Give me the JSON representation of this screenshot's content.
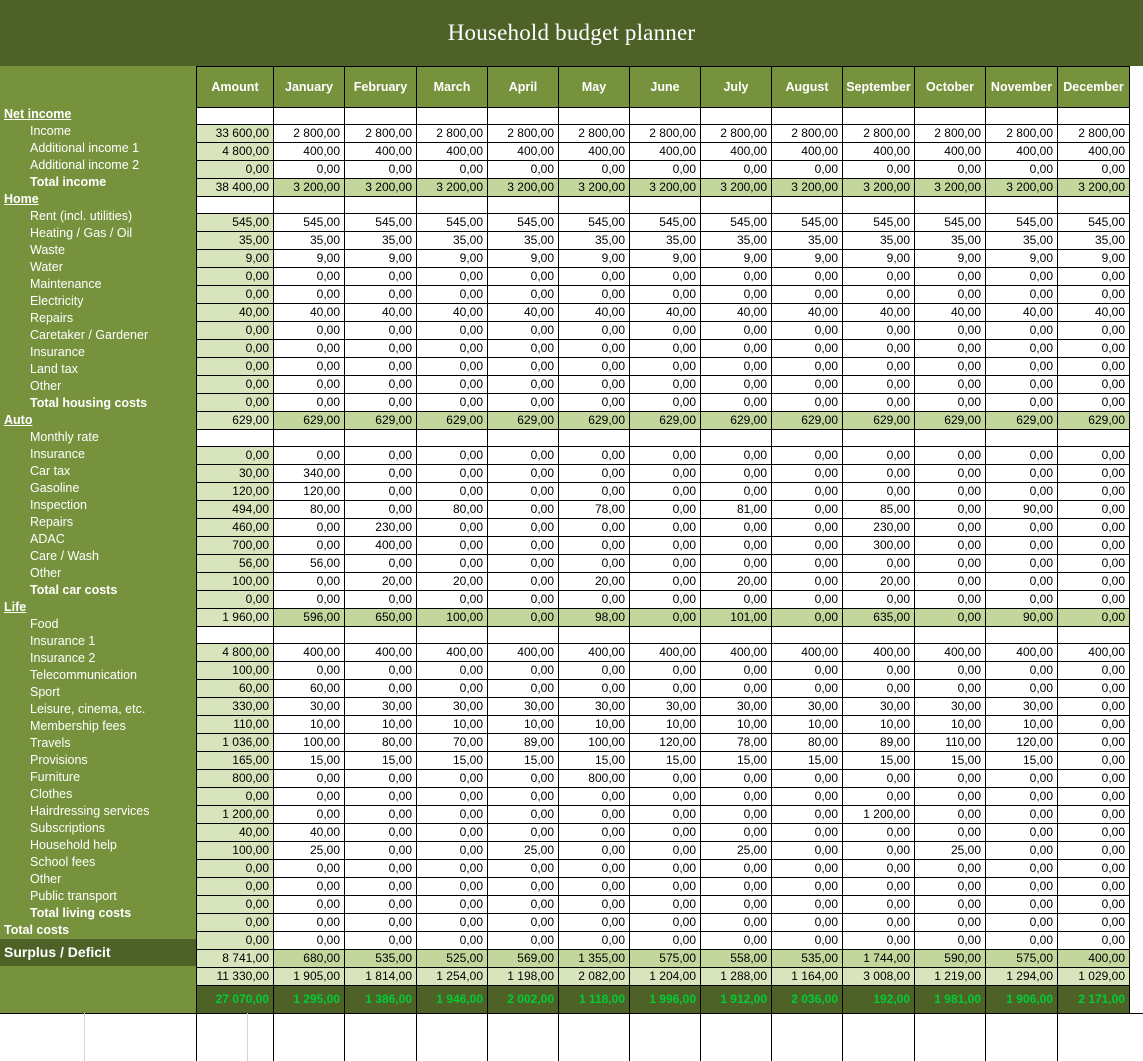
{
  "title": "Household budget planner",
  "theme": {
    "banner": "#4e6228",
    "header": "#76923c",
    "amount_fill": "#d8e4bc",
    "total_fill": "#c3d69b",
    "surplus_bg": "#4e6228",
    "surplus_text": "#00cc33"
  },
  "columns": [
    "Amount",
    "January",
    "February",
    "March",
    "April",
    "May",
    "June",
    "July",
    "August",
    "September",
    "October",
    "November",
    "December"
  ],
  "sections": [
    {
      "name": "Net income",
      "rows": [
        {
          "label": "Income",
          "kind": "item",
          "values": [
            "33 600,00",
            "2 800,00",
            "2 800,00",
            "2 800,00",
            "2 800,00",
            "2 800,00",
            "2 800,00",
            "2 800,00",
            "2 800,00",
            "2 800,00",
            "2 800,00",
            "2 800,00",
            "2 800,00"
          ]
        },
        {
          "label": "Additional income 1",
          "kind": "item",
          "values": [
            "4 800,00",
            "400,00",
            "400,00",
            "400,00",
            "400,00",
            "400,00",
            "400,00",
            "400,00",
            "400,00",
            "400,00",
            "400,00",
            "400,00",
            "400,00"
          ]
        },
        {
          "label": "Additional income 2",
          "kind": "item",
          "values": [
            "0,00",
            "0,00",
            "0,00",
            "0,00",
            "0,00",
            "0,00",
            "0,00",
            "0,00",
            "0,00",
            "0,00",
            "0,00",
            "0,00",
            "0,00"
          ]
        },
        {
          "label": "Total income",
          "kind": "total",
          "values": [
            "38 400,00",
            "3 200,00",
            "3 200,00",
            "3 200,00",
            "3 200,00",
            "3 200,00",
            "3 200,00",
            "3 200,00",
            "3 200,00",
            "3 200,00",
            "3 200,00",
            "3 200,00",
            "3 200,00"
          ]
        }
      ]
    },
    {
      "name": "Home",
      "rows": [
        {
          "label": "Rent (incl. utilities)",
          "kind": "item",
          "values": [
            "545,00",
            "545,00",
            "545,00",
            "545,00",
            "545,00",
            "545,00",
            "545,00",
            "545,00",
            "545,00",
            "545,00",
            "545,00",
            "545,00",
            "545,00"
          ]
        },
        {
          "label": "Heating / Gas / Oil",
          "kind": "item",
          "values": [
            "35,00",
            "35,00",
            "35,00",
            "35,00",
            "35,00",
            "35,00",
            "35,00",
            "35,00",
            "35,00",
            "35,00",
            "35,00",
            "35,00",
            "35,00"
          ]
        },
        {
          "label": "Waste",
          "kind": "item",
          "values": [
            "9,00",
            "9,00",
            "9,00",
            "9,00",
            "9,00",
            "9,00",
            "9,00",
            "9,00",
            "9,00",
            "9,00",
            "9,00",
            "9,00",
            "9,00"
          ]
        },
        {
          "label": "Water",
          "kind": "item",
          "values": [
            "0,00",
            "0,00",
            "0,00",
            "0,00",
            "0,00",
            "0,00",
            "0,00",
            "0,00",
            "0,00",
            "0,00",
            "0,00",
            "0,00",
            "0,00"
          ]
        },
        {
          "label": "Maintenance",
          "kind": "item",
          "values": [
            "0,00",
            "0,00",
            "0,00",
            "0,00",
            "0,00",
            "0,00",
            "0,00",
            "0,00",
            "0,00",
            "0,00",
            "0,00",
            "0,00",
            "0,00"
          ]
        },
        {
          "label": "Electricity",
          "kind": "item",
          "values": [
            "40,00",
            "40,00",
            "40,00",
            "40,00",
            "40,00",
            "40,00",
            "40,00",
            "40,00",
            "40,00",
            "40,00",
            "40,00",
            "40,00",
            "40,00"
          ]
        },
        {
          "label": "Repairs",
          "kind": "item",
          "values": [
            "0,00",
            "0,00",
            "0,00",
            "0,00",
            "0,00",
            "0,00",
            "0,00",
            "0,00",
            "0,00",
            "0,00",
            "0,00",
            "0,00",
            "0,00"
          ]
        },
        {
          "label": "Caretaker / Gardener",
          "kind": "item",
          "values": [
            "0,00",
            "0,00",
            "0,00",
            "0,00",
            "0,00",
            "0,00",
            "0,00",
            "0,00",
            "0,00",
            "0,00",
            "0,00",
            "0,00",
            "0,00"
          ]
        },
        {
          "label": "Insurance",
          "kind": "item",
          "values": [
            "0,00",
            "0,00",
            "0,00",
            "0,00",
            "0,00",
            "0,00",
            "0,00",
            "0,00",
            "0,00",
            "0,00",
            "0,00",
            "0,00",
            "0,00"
          ]
        },
        {
          "label": "Land tax",
          "kind": "item",
          "values": [
            "0,00",
            "0,00",
            "0,00",
            "0,00",
            "0,00",
            "0,00",
            "0,00",
            "0,00",
            "0,00",
            "0,00",
            "0,00",
            "0,00",
            "0,00"
          ]
        },
        {
          "label": "Other",
          "kind": "item",
          "values": [
            "0,00",
            "0,00",
            "0,00",
            "0,00",
            "0,00",
            "0,00",
            "0,00",
            "0,00",
            "0,00",
            "0,00",
            "0,00",
            "0,00",
            "0,00"
          ]
        },
        {
          "label": "Total housing costs",
          "kind": "total",
          "values": [
            "629,00",
            "629,00",
            "629,00",
            "629,00",
            "629,00",
            "629,00",
            "629,00",
            "629,00",
            "629,00",
            "629,00",
            "629,00",
            "629,00",
            "629,00"
          ]
        }
      ]
    },
    {
      "name": "Auto",
      "rows": [
        {
          "label": "Monthly rate",
          "kind": "item",
          "values": [
            "0,00",
            "0,00",
            "0,00",
            "0,00",
            "0,00",
            "0,00",
            "0,00",
            "0,00",
            "0,00",
            "0,00",
            "0,00",
            "0,00",
            "0,00"
          ]
        },
        {
          "label": "Insurance",
          "kind": "item",
          "values": [
            "30,00",
            "340,00",
            "0,00",
            "0,00",
            "0,00",
            "0,00",
            "0,00",
            "0,00",
            "0,00",
            "0,00",
            "0,00",
            "0,00",
            "0,00"
          ]
        },
        {
          "label": "Car tax",
          "kind": "item",
          "values": [
            "120,00",
            "120,00",
            "0,00",
            "0,00",
            "0,00",
            "0,00",
            "0,00",
            "0,00",
            "0,00",
            "0,00",
            "0,00",
            "0,00",
            "0,00"
          ]
        },
        {
          "label": "Gasoline",
          "kind": "item",
          "values": [
            "494,00",
            "80,00",
            "0,00",
            "80,00",
            "0,00",
            "78,00",
            "0,00",
            "81,00",
            "0,00",
            "85,00",
            "0,00",
            "90,00",
            "0,00"
          ]
        },
        {
          "label": "Inspection",
          "kind": "item",
          "values": [
            "460,00",
            "0,00",
            "230,00",
            "0,00",
            "0,00",
            "0,00",
            "0,00",
            "0,00",
            "0,00",
            "230,00",
            "0,00",
            "0,00",
            "0,00"
          ]
        },
        {
          "label": "Repairs",
          "kind": "item",
          "values": [
            "700,00",
            "0,00",
            "400,00",
            "0,00",
            "0,00",
            "0,00",
            "0,00",
            "0,00",
            "0,00",
            "300,00",
            "0,00",
            "0,00",
            "0,00"
          ]
        },
        {
          "label": "ADAC",
          "kind": "item",
          "values": [
            "56,00",
            "56,00",
            "0,00",
            "0,00",
            "0,00",
            "0,00",
            "0,00",
            "0,00",
            "0,00",
            "0,00",
            "0,00",
            "0,00",
            "0,00"
          ]
        },
        {
          "label": "Care / Wash",
          "kind": "item",
          "values": [
            "100,00",
            "0,00",
            "20,00",
            "20,00",
            "0,00",
            "20,00",
            "0,00",
            "20,00",
            "0,00",
            "20,00",
            "0,00",
            "0,00",
            "0,00"
          ]
        },
        {
          "label": "Other",
          "kind": "item",
          "values": [
            "0,00",
            "0,00",
            "0,00",
            "0,00",
            "0,00",
            "0,00",
            "0,00",
            "0,00",
            "0,00",
            "0,00",
            "0,00",
            "0,00",
            "0,00"
          ]
        },
        {
          "label": "Total car costs",
          "kind": "total",
          "values": [
            "1 960,00",
            "596,00",
            "650,00",
            "100,00",
            "0,00",
            "98,00",
            "0,00",
            "101,00",
            "0,00",
            "635,00",
            "0,00",
            "90,00",
            "0,00"
          ]
        }
      ]
    },
    {
      "name": "Life",
      "rows": [
        {
          "label": "Food",
          "kind": "item",
          "values": [
            "4 800,00",
            "400,00",
            "400,00",
            "400,00",
            "400,00",
            "400,00",
            "400,00",
            "400,00",
            "400,00",
            "400,00",
            "400,00",
            "400,00",
            "400,00"
          ]
        },
        {
          "label": "Insurance 1",
          "kind": "item",
          "values": [
            "100,00",
            "0,00",
            "0,00",
            "0,00",
            "0,00",
            "0,00",
            "0,00",
            "0,00",
            "0,00",
            "0,00",
            "0,00",
            "0,00",
            "0,00"
          ]
        },
        {
          "label": "Insurance 2",
          "kind": "item",
          "values": [
            "60,00",
            "60,00",
            "0,00",
            "0,00",
            "0,00",
            "0,00",
            "0,00",
            "0,00",
            "0,00",
            "0,00",
            "0,00",
            "0,00",
            "0,00"
          ]
        },
        {
          "label": "Telecommunication",
          "kind": "item",
          "values": [
            "330,00",
            "30,00",
            "30,00",
            "30,00",
            "30,00",
            "30,00",
            "30,00",
            "30,00",
            "30,00",
            "30,00",
            "30,00",
            "30,00",
            "0,00"
          ]
        },
        {
          "label": "Sport",
          "kind": "item",
          "values": [
            "110,00",
            "10,00",
            "10,00",
            "10,00",
            "10,00",
            "10,00",
            "10,00",
            "10,00",
            "10,00",
            "10,00",
            "10,00",
            "10,00",
            "0,00"
          ]
        },
        {
          "label": "Leisure, cinema, etc.",
          "kind": "item",
          "values": [
            "1 036,00",
            "100,00",
            "80,00",
            "70,00",
            "89,00",
            "100,00",
            "120,00",
            "78,00",
            "80,00",
            "89,00",
            "110,00",
            "120,00",
            "0,00"
          ]
        },
        {
          "label": "Membership fees",
          "kind": "item",
          "values": [
            "165,00",
            "15,00",
            "15,00",
            "15,00",
            "15,00",
            "15,00",
            "15,00",
            "15,00",
            "15,00",
            "15,00",
            "15,00",
            "15,00",
            "0,00"
          ]
        },
        {
          "label": "Travels",
          "kind": "item",
          "values": [
            "800,00",
            "0,00",
            "0,00",
            "0,00",
            "0,00",
            "800,00",
            "0,00",
            "0,00",
            "0,00",
            "0,00",
            "0,00",
            "0,00",
            "0,00"
          ]
        },
        {
          "label": "Provisions",
          "kind": "item",
          "values": [
            "0,00",
            "0,00",
            "0,00",
            "0,00",
            "0,00",
            "0,00",
            "0,00",
            "0,00",
            "0,00",
            "0,00",
            "0,00",
            "0,00",
            "0,00"
          ]
        },
        {
          "label": "Furniture",
          "kind": "item",
          "values": [
            "1 200,00",
            "0,00",
            "0,00",
            "0,00",
            "0,00",
            "0,00",
            "0,00",
            "0,00",
            "0,00",
            "1 200,00",
            "0,00",
            "0,00",
            "0,00"
          ]
        },
        {
          "label": "Clothes",
          "kind": "item",
          "values": [
            "40,00",
            "40,00",
            "0,00",
            "0,00",
            "0,00",
            "0,00",
            "0,00",
            "0,00",
            "0,00",
            "0,00",
            "0,00",
            "0,00",
            "0,00"
          ]
        },
        {
          "label": "Hairdressing services",
          "kind": "item",
          "values": [
            "100,00",
            "25,00",
            "0,00",
            "0,00",
            "25,00",
            "0,00",
            "0,00",
            "25,00",
            "0,00",
            "0,00",
            "25,00",
            "0,00",
            "0,00"
          ]
        },
        {
          "label": "Subscriptions",
          "kind": "item",
          "values": [
            "0,00",
            "0,00",
            "0,00",
            "0,00",
            "0,00",
            "0,00",
            "0,00",
            "0,00",
            "0,00",
            "0,00",
            "0,00",
            "0,00",
            "0,00"
          ]
        },
        {
          "label": "Household help",
          "kind": "item",
          "values": [
            "0,00",
            "0,00",
            "0,00",
            "0,00",
            "0,00",
            "0,00",
            "0,00",
            "0,00",
            "0,00",
            "0,00",
            "0,00",
            "0,00",
            "0,00"
          ]
        },
        {
          "label": "School fees",
          "kind": "item",
          "values": [
            "0,00",
            "0,00",
            "0,00",
            "0,00",
            "0,00",
            "0,00",
            "0,00",
            "0,00",
            "0,00",
            "0,00",
            "0,00",
            "0,00",
            "0,00"
          ]
        },
        {
          "label": "Other",
          "kind": "item",
          "values": [
            "0,00",
            "0,00",
            "0,00",
            "0,00",
            "0,00",
            "0,00",
            "0,00",
            "0,00",
            "0,00",
            "0,00",
            "0,00",
            "0,00",
            "0,00"
          ]
        },
        {
          "label": "Public transport",
          "kind": "item",
          "values": [
            "0,00",
            "0,00",
            "0,00",
            "0,00",
            "0,00",
            "0,00",
            "0,00",
            "0,00",
            "0,00",
            "0,00",
            "0,00",
            "0,00",
            "0,00"
          ]
        },
        {
          "label": "Total living costs",
          "kind": "total",
          "values": [
            "8 741,00",
            "680,00",
            "535,00",
            "525,00",
            "569,00",
            "1 355,00",
            "575,00",
            "558,00",
            "535,00",
            "1 744,00",
            "590,00",
            "575,00",
            "400,00"
          ]
        }
      ]
    }
  ],
  "grand_total": {
    "label": "Total costs",
    "values": [
      "11 330,00",
      "1 905,00",
      "1 814,00",
      "1 254,00",
      "1 198,00",
      "2 082,00",
      "1 204,00",
      "1 288,00",
      "1 164,00",
      "3 008,00",
      "1 219,00",
      "1 294,00",
      "1 029,00"
    ]
  },
  "surplus": {
    "label": "Surplus / Deficit",
    "values": [
      "27 070,00",
      "1 295,00",
      "1 386,00",
      "1 946,00",
      "2 002,00",
      "1 118,00",
      "1 996,00",
      "1 912,00",
      "2 036,00",
      "192,00",
      "1 981,00",
      "1 906,00",
      "2 171,00"
    ]
  }
}
